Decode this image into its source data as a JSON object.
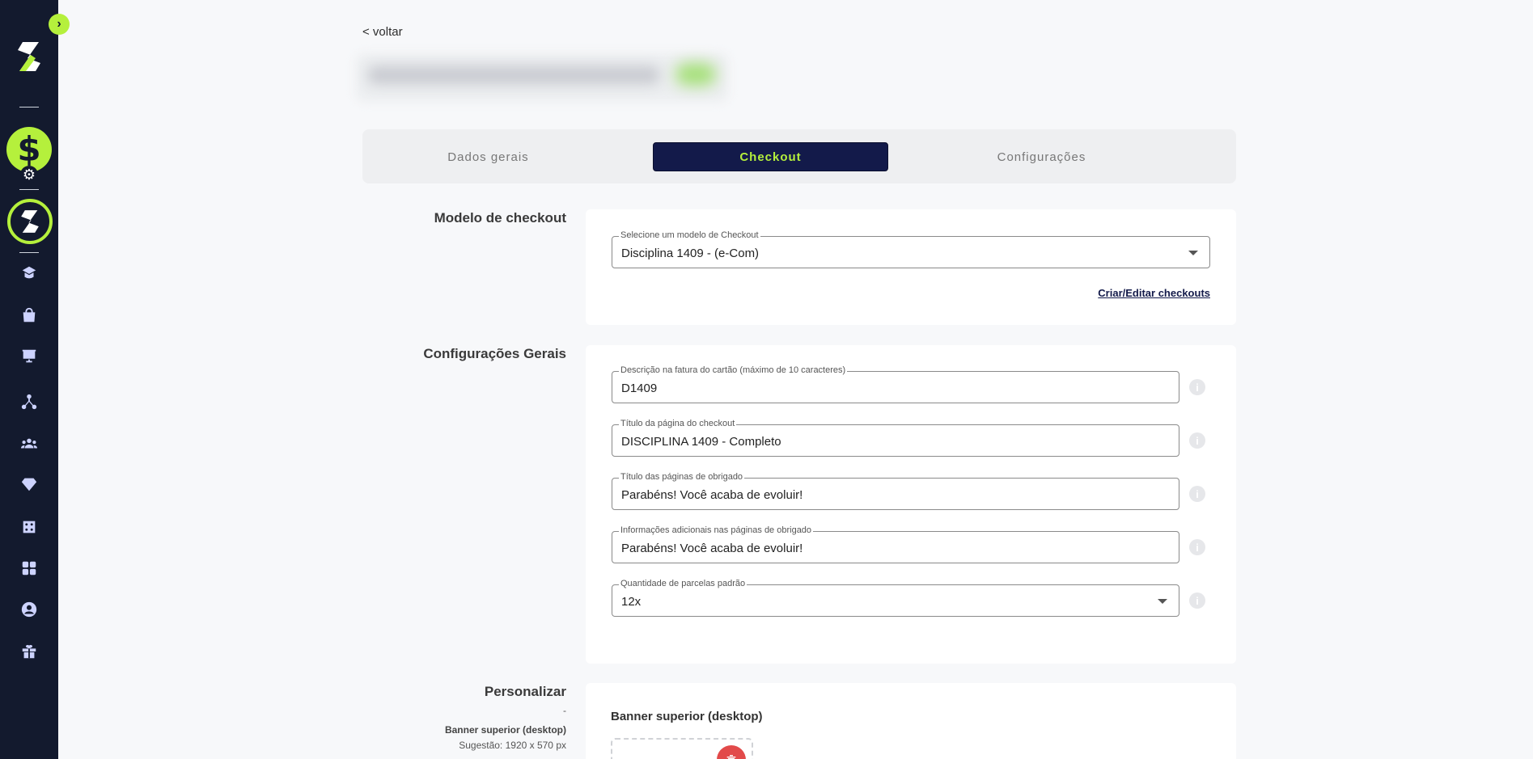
{
  "nav": {
    "back_label": "< voltar"
  },
  "tabs": [
    {
      "label": "Dados gerais",
      "active": false
    },
    {
      "label": "Checkout",
      "active": true
    },
    {
      "label": "Configurações",
      "active": false
    }
  ],
  "checkout_model": {
    "section_title": "Modelo de checkout",
    "select_label": "Selecione um modelo de Checkout",
    "select_value": "Disciplina 1409 - (e-Com)",
    "edit_link": "Criar/Editar checkouts"
  },
  "general_settings": {
    "section_title": "Configurações Gerais",
    "fields": [
      {
        "label": "Descrição na fatura do cartão (máximo de 10 caracteres)",
        "value": "D1409"
      },
      {
        "label": "Título da página do checkout",
        "value": "DISCIPLINA 1409 - Completo"
      },
      {
        "label": "Título das páginas de obrigado",
        "value": "Parabéns! Você acaba de evoluir!"
      },
      {
        "label": "Informações adicionais nas páginas de obrigado",
        "value": "Parabéns! Você acaba de evoluir!"
      },
      {
        "label": "Quantidade de parcelas padrão",
        "value": "12x"
      }
    ]
  },
  "customize": {
    "section_title": "Personalizar",
    "dot": "-",
    "banner_label": "Banner superior (desktop)",
    "banner_hint": "Sugestão: 1920 x 570 px",
    "banner_title": "Banner superior (desktop)"
  },
  "colors": {
    "sidebar_bg": "#131a2e",
    "accent": "#b5f03c",
    "active_tab_bg": "#131a4a",
    "delete_red": "#e24a4a"
  },
  "icons": [
    "chevron-right-icon",
    "brand-logo-icon",
    "dollar-icon",
    "gear-icon",
    "ring-logo-icon",
    "school-icon",
    "shopping-bag-icon",
    "presentation-icon",
    "network-icon",
    "group-icon",
    "diamond-icon",
    "dice-icon",
    "apps-icon",
    "account-icon",
    "gift-icon",
    "info-icon",
    "trash-icon"
  ]
}
